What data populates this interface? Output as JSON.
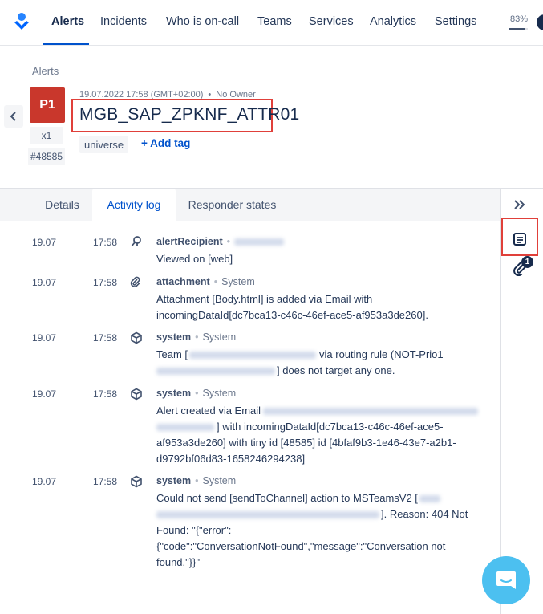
{
  "nav": {
    "items": [
      "Alerts",
      "Incidents",
      "Who is on-call",
      "Teams",
      "Services",
      "Analytics",
      "Settings"
    ],
    "active_index": 0,
    "progress_text": "83%",
    "progress_value": 0.83
  },
  "alert": {
    "breadcrumb": "Alerts",
    "priority": "P1",
    "count": "x1",
    "tiny_id": "#48585",
    "datetime": "19.07.2022 17:58 (GMT+02:00)",
    "owner": "No Owner",
    "title": "MGB_SAP_ZPKNF_ATTR01",
    "tags": [
      "universe"
    ],
    "add_tag_label": "+ Add tag"
  },
  "tabs": [
    {
      "label": "Details"
    },
    {
      "label": "Activity log"
    },
    {
      "label": "Responder states"
    }
  ],
  "side_panel": {
    "attachment_count": "1"
  },
  "activity": [
    {
      "date": "19.07",
      "time": "17:58",
      "icon": "alert-recipient-icon",
      "type": "alertRecipient",
      "lines": [
        "Viewed on [web]"
      ]
    },
    {
      "date": "19.07",
      "time": "17:58",
      "icon": "paperclip-icon",
      "type": "attachment",
      "source": "System",
      "lines": [
        "Attachment [Body.html] is added via Email with",
        "incomingDataId[dc7bca13-c46c-46ef-ace5-af953a3de260]."
      ]
    },
    {
      "date": "19.07",
      "time": "17:58",
      "icon": "cube-icon",
      "type": "system",
      "source": "System",
      "line1_a": "Team [",
      "line1_b": "via routing rule (NOT-Prio1",
      "line2_b": "] does not target any one."
    },
    {
      "date": "19.07",
      "time": "17:58",
      "icon": "cube-icon",
      "type": "system",
      "source": "System",
      "line1_a": "Alert created via Email",
      "line2_b": "] with incomingDataId[dc7bca13-c46c-46ef-ace5-",
      "lines": [
        "af953a3de260] with tiny id [48585] id [4bfaf9b3-1e46-43e7-a2b1-",
        "d9792bf06d83-1658246294238]"
      ]
    },
    {
      "date": "19.07",
      "time": "17:58",
      "icon": "cube-icon",
      "type": "system",
      "source": "System",
      "line1_a": "Could not send [sendToChannel] action to MSTeamsV2 [",
      "line2_b": "]. Reason: 404 Not",
      "lines": [
        "Found: \"{\"error\":",
        "{\"code\":\"ConversationNotFound\",\"message\":\"Conversation not",
        "found.\"}}\""
      ]
    }
  ]
}
